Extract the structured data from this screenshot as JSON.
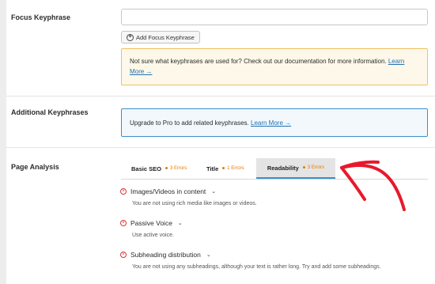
{
  "focus": {
    "label": "Focus Keyphrase",
    "input_value": "",
    "add_button": "Add Focus Keyphrase",
    "notice_text": "Not sure what keyphrases are used for? Check out our documentation for more information.",
    "notice_link": "Learn More →"
  },
  "additional": {
    "label": "Additional Keyphrases",
    "notice_text": "Upgrade to Pro to add related keyphrases.",
    "notice_link": "Learn More →"
  },
  "analysis": {
    "label": "Page Analysis",
    "tabs": [
      {
        "label": "Basic SEO",
        "errors": "3 Errors"
      },
      {
        "label": "Title",
        "errors": "1 Errors"
      },
      {
        "label": "Readability",
        "errors": "3 Errors"
      }
    ],
    "results": [
      {
        "title": "Images/Videos in content",
        "desc": "You are not using rich media like images or videos."
      },
      {
        "title": "Passive Voice",
        "desc": "Use active voice."
      },
      {
        "title": "Subheading distribution",
        "desc": "You are not using any subheadings, although your text is rather long. Try and add some subheadings."
      }
    ]
  },
  "colors": {
    "accent": "#2271b1",
    "error": "#d63638",
    "warning": "#e07b00",
    "arrow": "#e8192c"
  }
}
